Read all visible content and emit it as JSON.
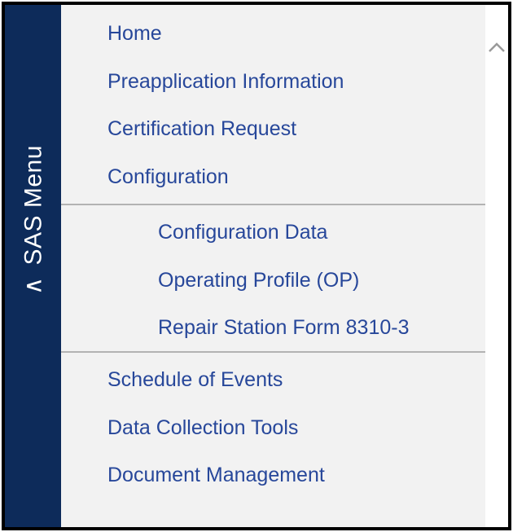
{
  "sidebar_tab": {
    "caret": "∧",
    "label": "SAS Menu"
  },
  "menu": {
    "top_items": [
      {
        "label": "Home"
      },
      {
        "label": "Preapplication Information"
      },
      {
        "label": "Certification Request"
      },
      {
        "label": "Configuration"
      }
    ],
    "configuration_subitems": [
      {
        "label": "Configuration Data"
      },
      {
        "label": "Operating Profile (OP)"
      },
      {
        "label": "Repair Station Form 8310-3"
      }
    ],
    "bottom_items": [
      {
        "label": "Schedule of Events"
      },
      {
        "label": "Data Collection Tools"
      },
      {
        "label": "Document Management"
      }
    ]
  },
  "scrollbar": {
    "up_icon": "chevron-up-icon"
  },
  "colors": {
    "tab_background": "#0d2b5a",
    "link_text": "#27479a",
    "menu_background": "#f2f2f2",
    "divider": "#b3b3b3"
  }
}
